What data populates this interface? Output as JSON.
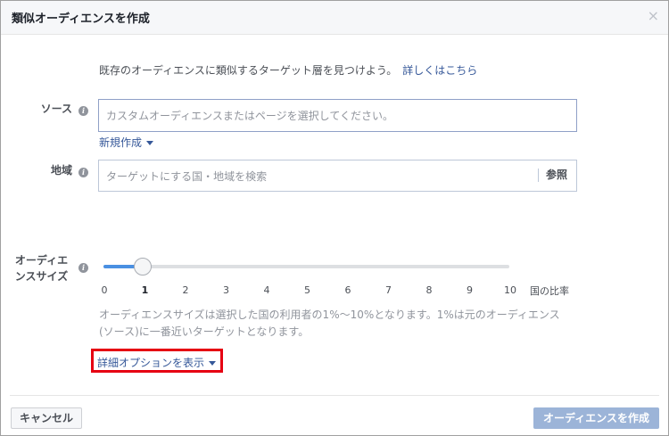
{
  "dialog": {
    "title": "類似オーディエンスを作成",
    "close_glyph": "×"
  },
  "intro": {
    "text": "既存のオーディエンスに類似するターゲット層を見つけよう。",
    "link": "詳しくはこちら"
  },
  "source": {
    "label": "ソース",
    "placeholder": "カスタムオーディエンスまたはページを選択してください。",
    "new_create": "新規作成"
  },
  "region": {
    "label": "地域",
    "placeholder": "ターゲットにする国・地域を検索",
    "browse": "参照"
  },
  "audience_size": {
    "label_line1": "オーディエ",
    "label_line2": "ンスサイズ",
    "selected_value": 1,
    "ticks": [
      "0",
      "1",
      "2",
      "3",
      "4",
      "5",
      "6",
      "7",
      "8",
      "9",
      "10"
    ],
    "unit_label": "国の比率",
    "note_line1": "オーディエンスサイズは選択した国の利用者の1%〜10%となります。1%は元のオーディエンス",
    "note_line2": "(ソース)に一番近いターゲットとなります。"
  },
  "advanced": {
    "label": "詳細オプションを表示"
  },
  "footer": {
    "cancel": "キャンセル",
    "create": "オーディエンスを作成"
  },
  "colors": {
    "link": "#365899",
    "slider_fill": "#4a90e2",
    "highlight_box": "#e60012",
    "create_button_disabled": "#9cb4d8"
  }
}
